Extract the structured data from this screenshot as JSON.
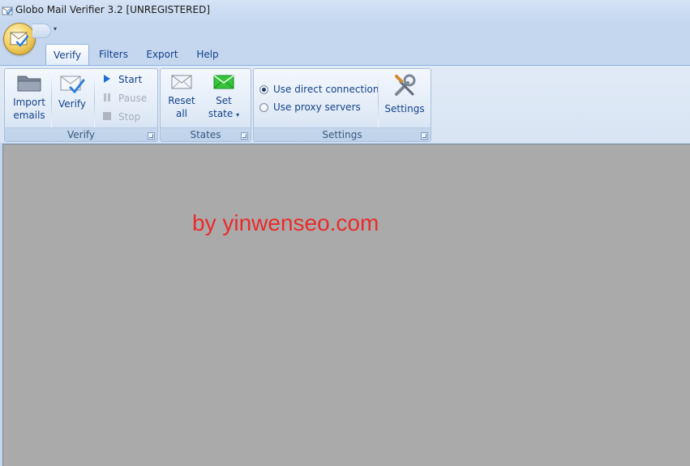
{
  "window": {
    "title": "Globo Mail Verifier 3.2 [UNREGISTERED]"
  },
  "ribbon": {
    "tabs": [
      "Verify",
      "Filters",
      "Export",
      "Help"
    ],
    "active_tab": "Verify",
    "verify_group": {
      "label": "Verify",
      "import_label_1": "Import",
      "import_label_2": "emails",
      "verify_label": "Verify",
      "start_label": "Start",
      "pause_label": "Pause",
      "stop_label": "Stop"
    },
    "states_group": {
      "label": "States",
      "reset_label_1": "Reset",
      "reset_label_2": "all",
      "set_label_1": "Set",
      "set_label_2": "state"
    },
    "settings_group": {
      "label": "Settings",
      "direct_label": "Use direct connection",
      "proxy_label": "Use proxy servers",
      "selected": "Use direct connection",
      "settings_label": "Settings"
    }
  },
  "workspace": {
    "watermark": "by yinwenseo.com"
  },
  "icons": {
    "app": "envelope-check-icon",
    "import": "folder-icon",
    "verify": "envelope-check-icon",
    "start": "play-icon",
    "pause": "pause-icon",
    "stop": "stop-icon",
    "reset": "envelope-icon",
    "set_state": "green-envelope-icon",
    "settings": "wrench-screwdriver-icon"
  },
  "colors": {
    "accent": "#15428b",
    "watermark": "#ea2b2b",
    "workspace": "#aaaaaa"
  }
}
